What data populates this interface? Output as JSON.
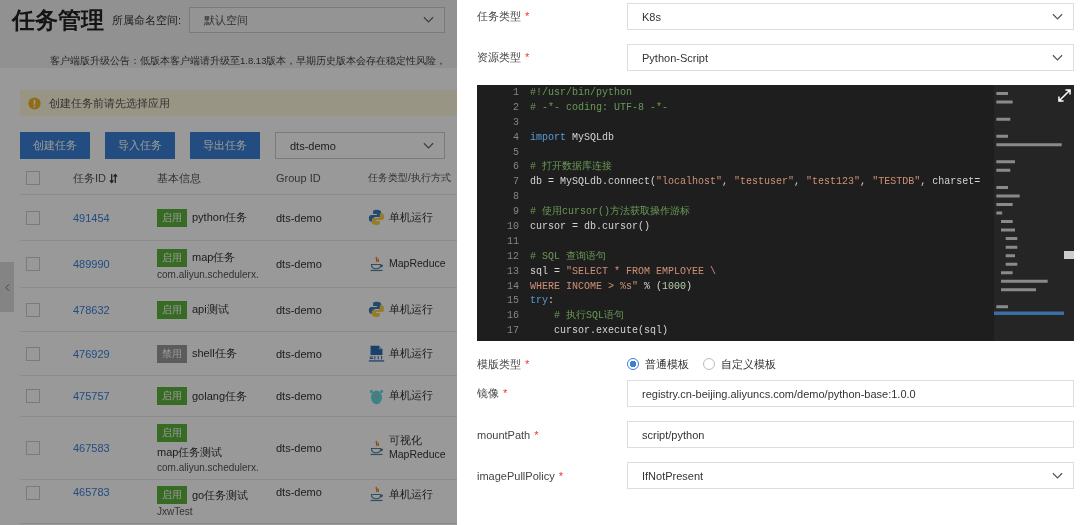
{
  "page": {
    "title": "任务管理",
    "namespace_label": "所属命名空间:",
    "namespace_value": "默认空间",
    "notice": "客户端版升级公告：低版本客户端请升级至1.8.13版本，早期历史版本会存在稳定性风险，",
    "alert": "创建任务前请先选择应用",
    "buttons": [
      "创建任务",
      "导入任务",
      "导出任务"
    ],
    "app_select": "dts-demo",
    "table": {
      "header_checked": false,
      "columns": [
        "任务ID",
        "基本信息",
        "Group ID",
        "任务类型/执行方式"
      ],
      "rows": [
        {
          "checked": false,
          "id": "491454",
          "status": {
            "label": "启用",
            "enabled": true
          },
          "badge_above": false,
          "name": "python任务",
          "group": "dts-demo",
          "kind": "python",
          "mode": "单机运行"
        },
        {
          "checked": false,
          "id": "489990",
          "status": {
            "label": "启用",
            "enabled": true
          },
          "badge_above": false,
          "name": "map任务",
          "sub": "com.aliyun.schedulerx.",
          "group": "dts-demo",
          "kind": "java",
          "mode": "MapReduce"
        },
        {
          "checked": false,
          "id": "478632",
          "status": {
            "label": "启用",
            "enabled": true
          },
          "badge_above": false,
          "name": "api测试",
          "group": "dts-demo",
          "kind": "python",
          "mode": "单机运行"
        },
        {
          "checked": false,
          "id": "476929",
          "status": {
            "label": "禁用",
            "enabled": false
          },
          "badge_above": false,
          "name": "shell任务",
          "group": "dts-demo",
          "kind": "shell",
          "mode": "单机运行"
        },
        {
          "checked": false,
          "id": "475757",
          "status": {
            "label": "启用",
            "enabled": true
          },
          "badge_above": false,
          "name": "golang任务",
          "group": "dts-demo",
          "kind": "go",
          "mode": "单机运行"
        },
        {
          "checked": false,
          "id": "467583",
          "status": {
            "label": "启用",
            "enabled": true
          },
          "badge_above": true,
          "name": "map任务测试",
          "sub": "com.aliyun.schedulerx.",
          "group": "dts-demo",
          "kind": "java",
          "mode": "可视化\nMapReduce"
        },
        {
          "checked": false,
          "id": "465783",
          "status": {
            "label": "启用",
            "enabled": true
          },
          "badge_above": false,
          "name": "go任务测试",
          "sub": "JxwTest",
          "group": "dts-demo",
          "kind": "java",
          "mode": "单机运行"
        }
      ]
    }
  },
  "drawer": {
    "fields": [
      {
        "kind": "select",
        "label": "任务类型",
        "required_mark": "*",
        "value": "K8s"
      },
      {
        "kind": "select",
        "label": "资源类型",
        "required_mark": "*",
        "value": "Python-Script"
      },
      {
        "kind": "code",
        "lines": [
          {
            "num": "1",
            "indent": false,
            "tokens": [
              {
                "kind": "comment",
                "s": "#!/usr/bin/python"
              }
            ]
          },
          {
            "num": "2",
            "indent": false,
            "tokens": [
              {
                "kind": "comment",
                "s": "# -*- coding: UTF-8 -*-"
              }
            ]
          },
          {
            "num": "3"
          },
          {
            "num": "4",
            "indent": false,
            "tokens": [
              {
                "kind": "keyword",
                "s": "import"
              },
              {
                "kind": "plain",
                "s": " MySQLdb"
              }
            ]
          },
          {
            "num": "5"
          },
          {
            "num": "6",
            "indent": false,
            "tokens": [
              {
                "kind": "comment",
                "s": "# 打开数据库连接"
              }
            ]
          },
          {
            "num": "7",
            "indent": false,
            "tokens": [
              {
                "kind": "plain",
                "s": "db = MySQLdb.connect("
              },
              {
                "kind": "string",
                "s": "\"localhost\""
              },
              {
                "kind": "plain",
                "s": ", "
              },
              {
                "kind": "string",
                "s": "\"testuser\""
              },
              {
                "kind": "plain",
                "s": ", "
              },
              {
                "kind": "string",
                "s": "\"test123\""
              },
              {
                "kind": "plain",
                "s": ", "
              },
              {
                "kind": "string",
                "s": "\"TESTDB\""
              },
              {
                "kind": "plain",
                "s": ", charset="
              }
            ]
          },
          {
            "num": "8"
          },
          {
            "num": "9",
            "indent": false,
            "tokens": [
              {
                "kind": "comment",
                "s": "# 使用cursor()方法获取操作游标"
              }
            ]
          },
          {
            "num": "10",
            "indent": false,
            "tokens": [
              {
                "kind": "plain",
                "s": "cursor = db.cursor()"
              }
            ]
          },
          {
            "num": "11"
          },
          {
            "num": "12",
            "indent": false,
            "tokens": [
              {
                "kind": "comment",
                "s": "# SQL 查询语句"
              }
            ]
          },
          {
            "num": "13",
            "indent": false,
            "tokens": [
              {
                "kind": "plain",
                "s": "sql = "
              },
              {
                "kind": "string",
                "s": "\"SELECT * FROM EMPLOYEE \\"
              }
            ]
          },
          {
            "num": "14",
            "indent": false,
            "tokens": [
              {
                "kind": "string",
                "s": "WHERE INCOME > %s\""
              },
              {
                "kind": "plain",
                "s": " % ("
              },
              {
                "kind": "number",
                "s": "1000"
              },
              {
                "kind": "plain",
                "s": ")"
              }
            ]
          },
          {
            "num": "15",
            "indent": false,
            "tokens": [
              {
                "kind": "keyword",
                "s": "try"
              },
              {
                "kind": "plain",
                "s": ":"
              }
            ]
          },
          {
            "num": "16",
            "indent": true,
            "tokens": [
              {
                "kind": "comment",
                "s": "# 执行SQL语句"
              }
            ]
          },
          {
            "num": "17",
            "indent": true,
            "tokens": [
              {
                "kind": "plain",
                "s": "cursor.execute(sql)"
              }
            ]
          }
        ]
      },
      {
        "kind": "radio",
        "label": "模版类型",
        "required_mark": "*",
        "options": [
          {
            "label": "普通模板",
            "selected": true
          },
          {
            "label": "自定义模板",
            "selected": false
          }
        ]
      },
      {
        "kind": "input",
        "label": "镜像",
        "required_mark": "*",
        "value": "registry.cn-beijing.aliyuncs.com/demo/python-base:1.0.0"
      },
      {
        "kind": "input",
        "label": "mountPath",
        "required_mark": "*",
        "value": "script/python"
      },
      {
        "kind": "select",
        "label": "imagePullPolicy",
        "required_mark": "*",
        "value": "IfNotPresent"
      }
    ]
  }
}
